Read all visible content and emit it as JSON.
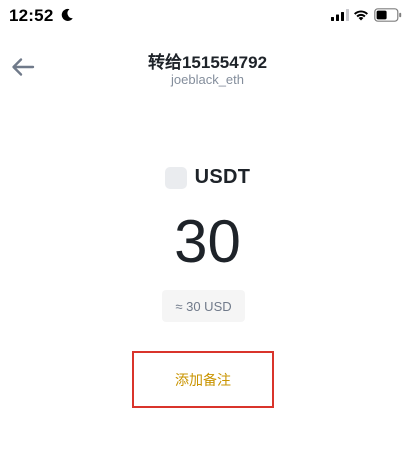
{
  "status_bar": {
    "time": "12:52",
    "icons": [
      "moon-icon",
      "signal-icon",
      "wifi-icon",
      "battery-icon"
    ]
  },
  "header": {
    "back_icon": "arrow-left-icon",
    "title": "转给151554792",
    "subtitle": "joeblack_eth"
  },
  "asset": {
    "icon": "coin-placeholder-icon",
    "name": "USDT"
  },
  "amount": "30",
  "fiat_equivalent": "≈ 30 USD",
  "add_note_label": "添加备注",
  "colors": {
    "accent": "#c99400",
    "highlight_border": "#d9342b",
    "text_primary": "#1e2329",
    "text_secondary": "#848e9c"
  }
}
